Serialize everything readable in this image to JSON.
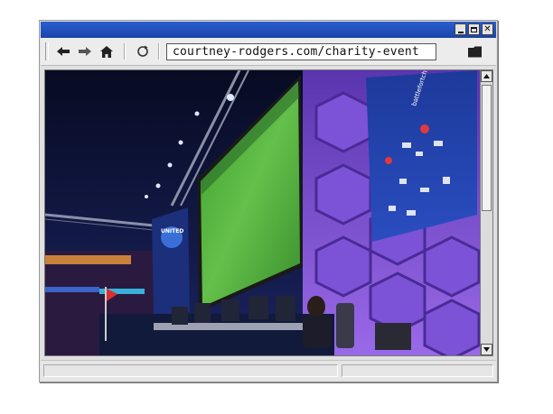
{
  "browser": {
    "address_url": "courtney-rodgers.com/charity-event",
    "status_left": "",
    "status_right": ""
  },
  "toolbar": {
    "icons": [
      "back-arrow-icon",
      "forward-arrow-icon",
      "home-icon",
      "refresh-icon",
      "folder-icon"
    ]
  },
  "titlebar": {
    "buttons": [
      "minimize-button",
      "maximize-button",
      "close-button"
    ],
    "color": "#1f4fb8"
  },
  "page": {
    "photo_description_colors": {
      "screen_green": "#4fae3a",
      "panel_purple": "#8a5ce0",
      "banner_blue": "#2547a8"
    },
    "banner_left_text": "UNITED",
    "banner_right_text": "battlefortcharity.tv"
  }
}
